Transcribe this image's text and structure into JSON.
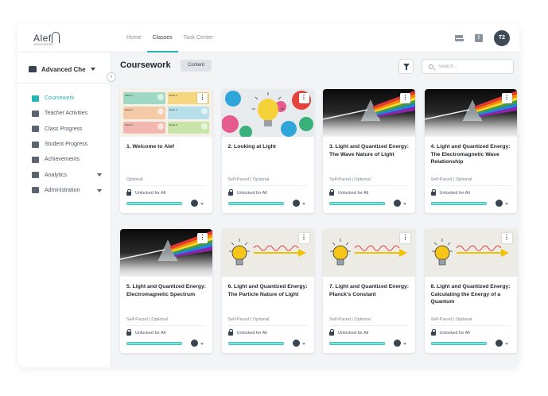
{
  "app": {
    "logo_text": "Alef",
    "logo_sub": "EDUCATION",
    "nav": [
      {
        "label": "Home",
        "active": false
      },
      {
        "label": "Classes",
        "active": true
      },
      {
        "label": "Task Center",
        "active": false
      }
    ],
    "avatar_initials": "T2",
    "icons": {
      "mail": "mail-icon",
      "help": "help-icon"
    }
  },
  "sidebar": {
    "course_name": "Advanced Chem",
    "items": [
      {
        "label": "Coursework",
        "icon": "book-icon",
        "active": true,
        "has_caret": false
      },
      {
        "label": "Teacher Activities",
        "icon": "teacher-icon",
        "active": false,
        "has_caret": false
      },
      {
        "label": "Class Progress",
        "icon": "chart-icon",
        "active": false,
        "has_caret": false
      },
      {
        "label": "Student Progress",
        "icon": "clipboard-icon",
        "active": false,
        "has_caret": false
      },
      {
        "label": "Achievements",
        "icon": "list-icon",
        "active": false,
        "has_caret": false
      },
      {
        "label": "Analytics",
        "icon": "analytics-icon",
        "active": false,
        "has_caret": true
      },
      {
        "label": "Administration",
        "icon": "gear-icon",
        "active": false,
        "has_caret": true
      }
    ]
  },
  "main": {
    "title": "Coursework",
    "chip": "Content",
    "search_placeholder": "Search...",
    "cards": [
      {
        "title": "1. Welcome to Alef",
        "meta": "Optional",
        "lock": "Unlocked for All",
        "thumb": "grid",
        "progress": 1.0
      },
      {
        "title": "2. Looking at Light",
        "meta": "Self-Paced | Optional",
        "lock": "Unlocked for All",
        "thumb": "paper",
        "progress": 1.0
      },
      {
        "title": "3. Light and Quantized Energy: The Wave Nature of Light",
        "meta": "Self-Paced | Optional",
        "lock": "Unlocked for All",
        "thumb": "prism",
        "progress": 1.0
      },
      {
        "title": "4. Light and Quantized Energy: The Electromagnetic Wave Relationship",
        "meta": "Self-Paced | Optional",
        "lock": "Unlocked for All",
        "thumb": "prism",
        "progress": 1.0
      },
      {
        "title": "5. Light and Quantized Energy: Electromagnetic Spectrum",
        "meta": "Self-Paced | Optional",
        "lock": "Unlocked for All",
        "thumb": "prism",
        "progress": 1.0
      },
      {
        "title": "6. Light and Quantized Energy: The Particle Nature of Light",
        "meta": "Self-Paced | Optional",
        "lock": "Unlocked for All",
        "thumb": "bulb",
        "progress": 1.0
      },
      {
        "title": "7. Light and Quantized Energy: Planck's Constant",
        "meta": "Self-Paced | Optional",
        "lock": "Unlocked for All",
        "thumb": "bulb",
        "progress": 1.0
      },
      {
        "title": "8. Light and Quantized Energy: Calculating the Energy of a Quantum",
        "meta": "Self-Paced | Optional",
        "lock": "Unlocked for All",
        "thumb": "bulb",
        "progress": 1.0
      }
    ],
    "grid_thumb_cells": [
      {
        "label": "Week 1",
        "color": "#9fd9c6"
      },
      {
        "label": "Week 2",
        "color": "#f4d77f"
      },
      {
        "label": "Week 3",
        "color": "#f3c9a7"
      },
      {
        "label": "Week 4",
        "color": "#b7dfe9"
      },
      {
        "label": "Week 5",
        "color": "#f2b8b0"
      },
      {
        "label": "Week 6",
        "color": "#c9e4a9"
      }
    ]
  },
  "colors": {
    "accent": "#26b5b0",
    "progress": "#8fe0da",
    "dark": "#3a4450"
  }
}
